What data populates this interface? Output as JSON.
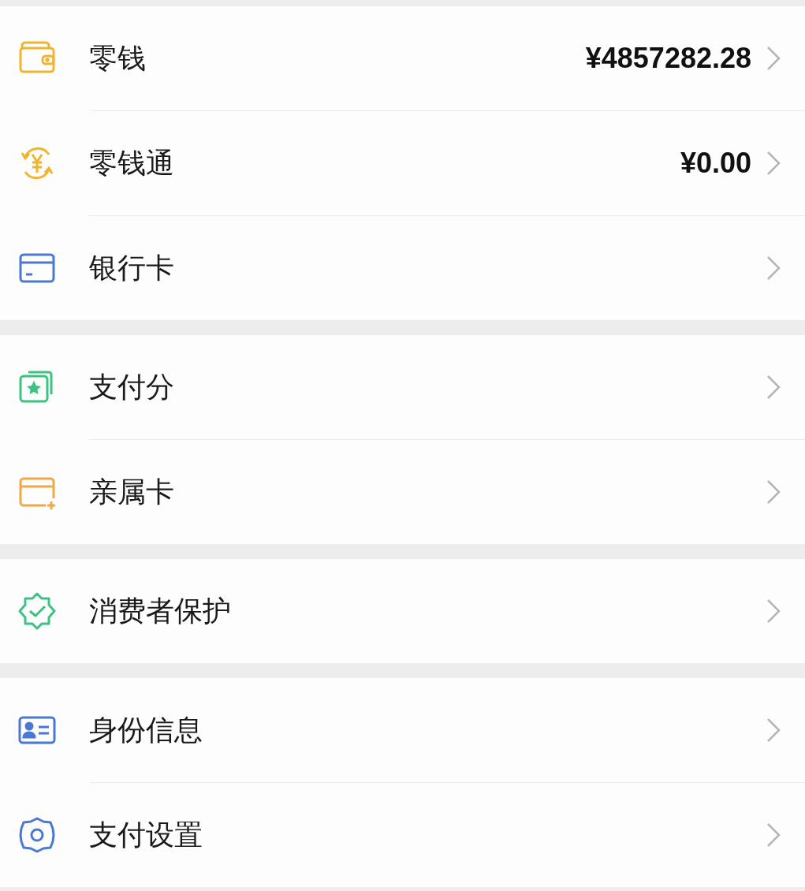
{
  "groups": [
    {
      "items": [
        {
          "label": "零钱",
          "value": "¥4857282.28"
        },
        {
          "label": "零钱通",
          "value": "¥0.00"
        },
        {
          "label": "银行卡"
        }
      ]
    },
    {
      "items": [
        {
          "label": "支付分"
        },
        {
          "label": "亲属卡"
        }
      ]
    },
    {
      "items": [
        {
          "label": "消费者保护"
        }
      ]
    },
    {
      "items": [
        {
          "label": "身份信息"
        },
        {
          "label": "支付设置"
        }
      ]
    }
  ]
}
